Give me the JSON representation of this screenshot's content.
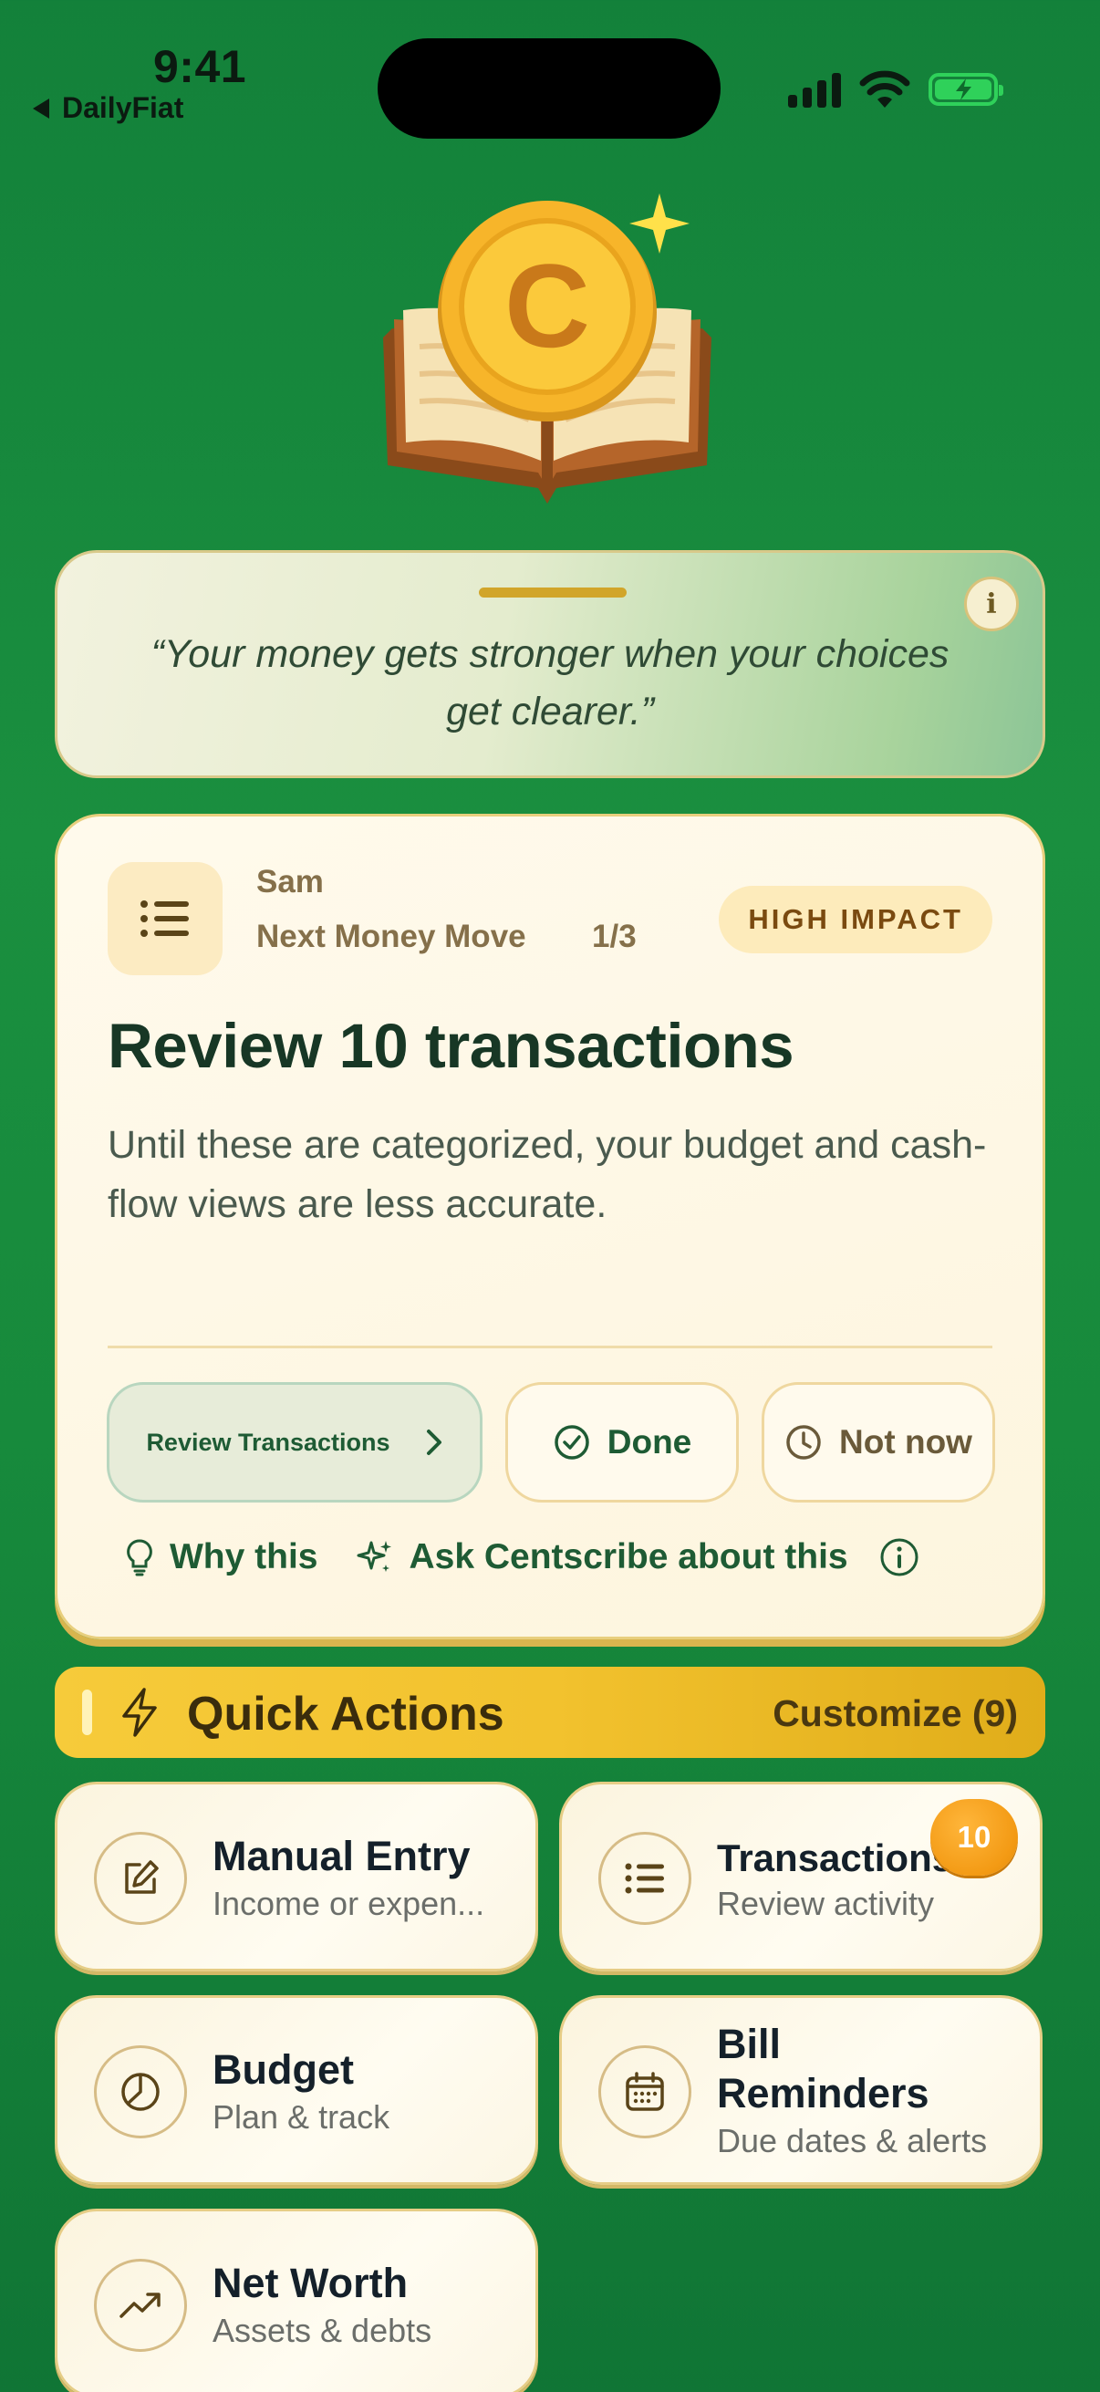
{
  "status_bar": {
    "time": "9:41",
    "back_app": "DailyFiat"
  },
  "quote": {
    "text": "“Your money gets stronger when your choices get clearer.”",
    "info_icon": "i"
  },
  "next_move": {
    "user": "Sam",
    "label": "Next Money Move",
    "counter": "1/3",
    "impact": "HIGH IMPACT",
    "headline": "Review 10 transactions",
    "description": "Until these are categorized, your budget and cash-flow views are less accurate.",
    "primary_button": "Review Transactions",
    "done_button": "Done",
    "later_button": "Not now",
    "why_link": "Why this",
    "ask_link": "Ask Centscribe about this"
  },
  "quick_actions": {
    "title": "Quick Actions",
    "customize": "Customize (9)",
    "tiles": [
      {
        "title": "Manual Entry",
        "subtitle": "Income or expen...",
        "icon": "edit-icon"
      },
      {
        "title": "Transactions",
        "subtitle": "Review activity",
        "icon": "list-icon",
        "badge": "10"
      },
      {
        "title": "Budget",
        "subtitle": "Plan & track",
        "icon": "pie-chart-icon"
      },
      {
        "title": "Bill Reminders",
        "subtitle": "Due dates & alerts",
        "icon": "calendar-icon"
      },
      {
        "title": "Net Worth",
        "subtitle": "Assets & debts",
        "icon": "trend-up-icon"
      }
    ]
  },
  "colors": {
    "background": "#1a8f3f",
    "card": "#fffaec",
    "accent_gold": "#f2c22e",
    "primary_text": "#173725",
    "badge_orange": "#f39a14"
  }
}
